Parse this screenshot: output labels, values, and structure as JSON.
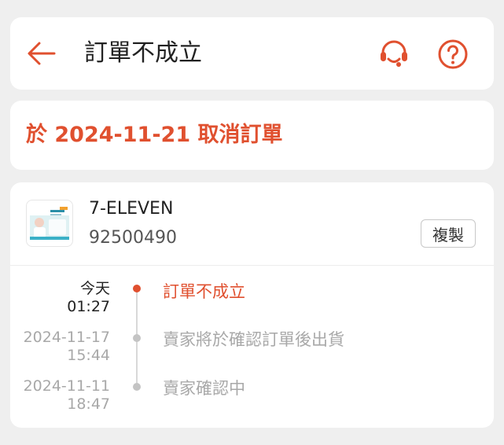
{
  "header": {
    "title": "訂單不成立"
  },
  "notice": {
    "text": "於 2024-11-21 取消訂單"
  },
  "shipment": {
    "store": "7-ELEVEN",
    "tracking_number": "92500490",
    "copy_label": "複製"
  },
  "timeline": [
    {
      "date": "今天",
      "time": "01:27",
      "event": "訂單不成立",
      "state": "current"
    },
    {
      "date": "2024-11-17",
      "time": "15:44",
      "event": "賣家將於確認訂單後出貨",
      "state": "past"
    },
    {
      "date": "2024-11-11",
      "time": "18:47",
      "event": "賣家確認中",
      "state": "past"
    }
  ],
  "colors": {
    "accent": "#e0502f",
    "muted": "#a8a8a8",
    "background": "#efefef"
  },
  "icons": {
    "back": "arrow-left-icon",
    "support": "headset-icon",
    "help": "question-icon"
  }
}
